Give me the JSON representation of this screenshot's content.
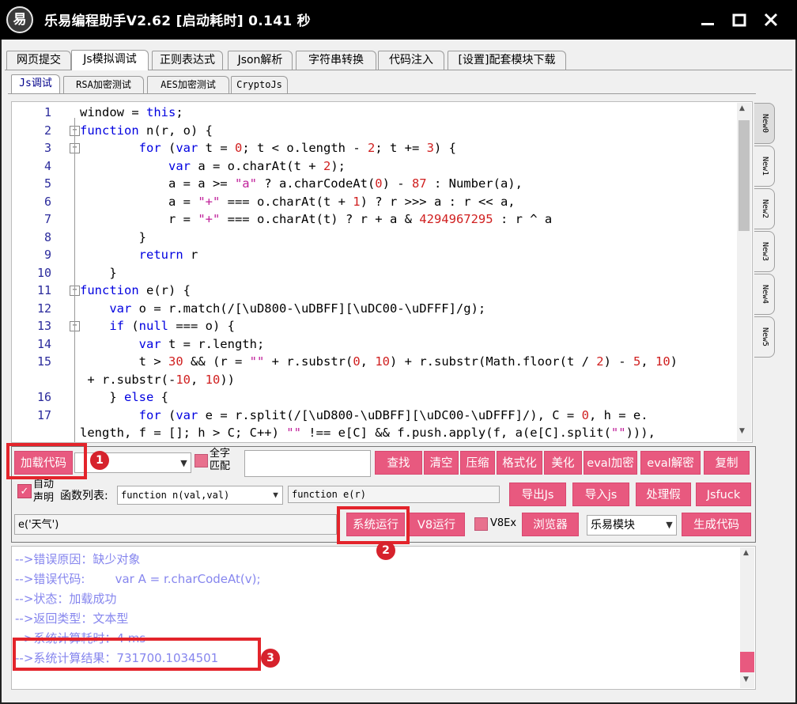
{
  "window": {
    "icon_glyph": "易",
    "title": "乐易编程助手V2.62 [启动耗时] 0.141 秒",
    "controls": [
      "minimize-icon",
      "maximize-icon",
      "close-icon"
    ]
  },
  "main_tabs": [
    "网页提交",
    "Js模拟调试",
    "正则表达式",
    "Json解析",
    "字符串转换",
    "代码注入",
    "[设置]配套模块下载"
  ],
  "main_tab_active": "Js模拟调试",
  "sub_tabs": [
    "Js调试",
    "RSA加密测试",
    "AES加密测试",
    "CryptoJs"
  ],
  "sub_tab_active": "Js调试",
  "side_tabs": [
    "New0",
    "New1",
    "New2",
    "New3",
    "New4",
    "New5"
  ],
  "editor": {
    "lines": [
      {
        "n": "1",
        "text": "window = this;"
      },
      {
        "n": "2",
        "text": "function n(r, o) {"
      },
      {
        "n": "3",
        "text": "        for (var t = 0; t < o.length - 2; t += 3) {"
      },
      {
        "n": "4",
        "text": "            var a = o.charAt(t + 2);"
      },
      {
        "n": "5",
        "text": "            a = a >= \"a\" ? a.charCodeAt(0) - 87 : Number(a),"
      },
      {
        "n": "6",
        "text": "            a = \"+\" === o.charAt(t + 1) ? r >>> a : r << a,"
      },
      {
        "n": "7",
        "text": "            r = \"+\" === o.charAt(t) ? r + a & 4294967295 : r ^ a"
      },
      {
        "n": "8",
        "text": "        }"
      },
      {
        "n": "9",
        "text": "        return r"
      },
      {
        "n": "10",
        "text": "    }"
      },
      {
        "n": "11",
        "text": "function e(r) {"
      },
      {
        "n": "12",
        "text": "    var o = r.match(/[\\uD800-\\uDBFF][\\uDC00-\\uDFFF]/g);"
      },
      {
        "n": "13",
        "text": "    if (null === o) {"
      },
      {
        "n": "14",
        "text": "        var t = r.length;"
      },
      {
        "n": "15",
        "text": "        t > 30 && (r = \"\" + r.substr(0, 10) + r.substr(Math.floor(t / 2) - 5, 10)"
      },
      {
        "n": "",
        "text": " + r.substr(-10, 10))"
      },
      {
        "n": "16",
        "text": "    } else {"
      },
      {
        "n": "17",
        "text": "        for (var e = r.split(/[\\uD800-\\uDBFF][\\uDC00-\\uDFFF]/), C = 0, h = e."
      },
      {
        "n": "",
        "text": "length, f = []; h > C; C++) \"\" !== e[C] && f.push.apply(f, a(e[C].split(\"\"))),"
      }
    ]
  },
  "controls": {
    "load_code": "加载代码",
    "full_match": "全字\n匹配",
    "search_value": "",
    "find": "查找",
    "clear": "清空",
    "compress": "压缩",
    "format": "格式化",
    "beautify": "美化",
    "eval_encrypt": "eval加密",
    "eval_decrypt": "eval解密",
    "copy": "复制",
    "auto_declare": "自动\n声明",
    "func_list_label": "函数列表:",
    "func_list_value": "function n(val,val)",
    "func_signature": "function e(r)",
    "export_js": "导出Js",
    "import_js": "导入js",
    "process_fake": "处理假",
    "jsfuck": "Jsfuck",
    "call_expression": "e('天气')",
    "system_run": "系统运行",
    "v8_run": "V8运行",
    "v8ex": "V8Ex",
    "browser": "浏览器",
    "module_select": "乐易模块",
    "generate_code": "生成代码"
  },
  "output": {
    "lines": [
      "-->错误原因：缺少对象",
      "-->错误代码:        var A = r.charCodeAt(v);",
      "-->状态：加载成功",
      "-->返回类型：文本型",
      "-->系统计算耗时：4 ms",
      "-->系统计算结果：731700.1034501"
    ]
  },
  "annotations": [
    "1",
    "2",
    "3"
  ],
  "colors": {
    "accent": "#e8597f",
    "annotation_red": "#e3242b",
    "output_text": "#8686ee"
  }
}
